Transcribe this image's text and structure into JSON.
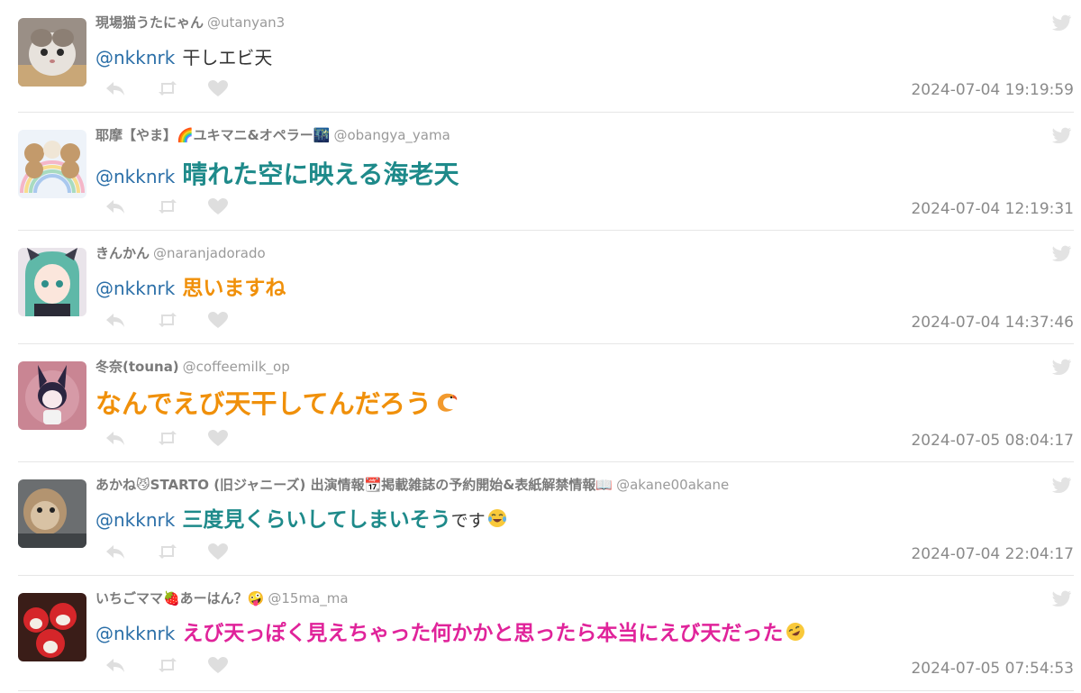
{
  "colors": {
    "mention": "#2b6fa8",
    "teal": "#1e8a8a",
    "orange": "#f0900a",
    "pink": "#e0239a",
    "meta": "#8a8a8a"
  },
  "tweets": [
    {
      "name": "現場猫うたにゃん",
      "handle": "@utanyan3",
      "mention": "@nkknrk",
      "text": "干しエビ天",
      "suffix": "",
      "timestamp": "2024-07-04 19:19:59"
    },
    {
      "name": "耶摩【やま】🌈ユキマニ&オペラー🌃",
      "handle": "@obangya_yama",
      "mention": "@nkknrk",
      "text": "晴れた空に映える海老天",
      "suffix": "",
      "timestamp": "2024-07-04 12:19:31"
    },
    {
      "name": "きんかん",
      "handle": "@naranjadorado",
      "mention": "@nkknrk",
      "text": "思いますね",
      "suffix": "",
      "timestamp": "2024-07-04 14:37:46"
    },
    {
      "name": "冬奈(touna)",
      "handle": "@coffeemilk_op",
      "mention": "",
      "text": "なんでえび天干してんだろう",
      "suffix": "",
      "timestamp": "2024-07-05 08:04:17"
    },
    {
      "name": "あかね😼STARTO (旧ジャニーズ) 出演情報📆掲載雑誌の予約開始&表紙解禁情報📖",
      "handle": "@akane00akane",
      "mention": "@nkknrk",
      "text": "三度見くらいしてしまいそう",
      "suffix": "です",
      "timestamp": "2024-07-04 22:04:17"
    },
    {
      "name": "いちごママ🍓あーはん？🤪",
      "handle": "@15ma_ma",
      "mention": "@nkknrk",
      "text": "えび天っぽく見えちゃった何かかと思ったら本当にえび天だった",
      "suffix": "",
      "timestamp": "2024-07-05 07:54:53"
    }
  ]
}
